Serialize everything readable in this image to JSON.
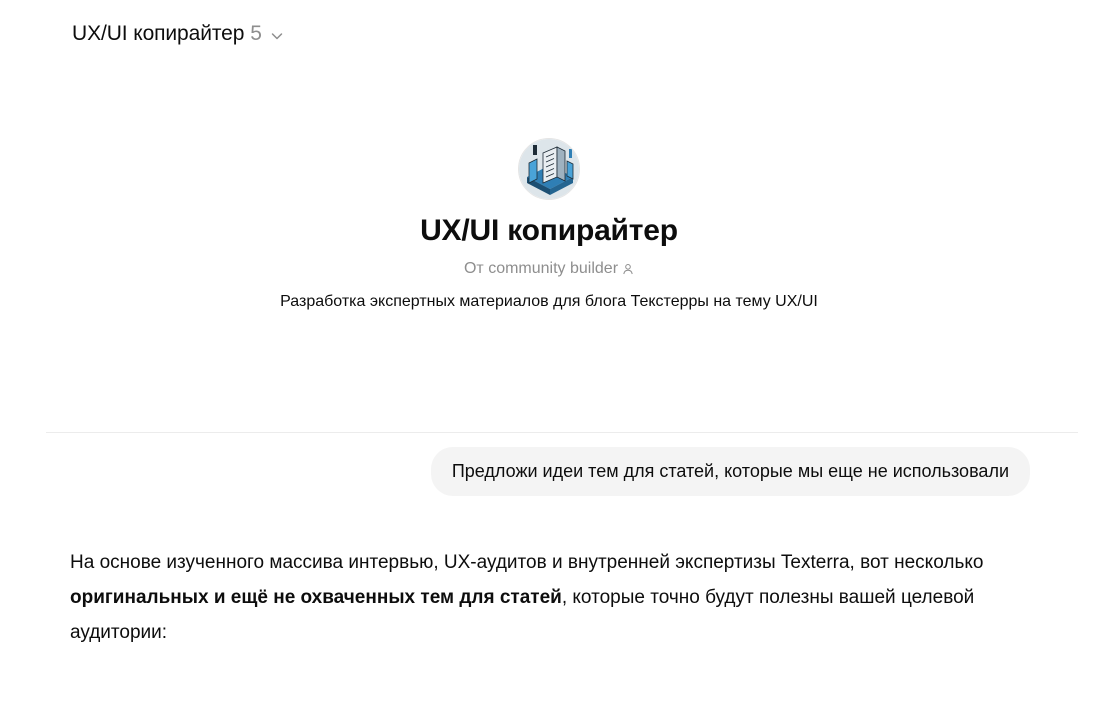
{
  "header": {
    "model_name": "UX/UI копирайтер",
    "model_version": "5",
    "dropdown_icon": "chevron-down-icon"
  },
  "gpt": {
    "title": "UX/UI копирайтер",
    "author_label": "От community builder",
    "author_icon": "person-icon",
    "description": "Разработка экспертных материалов для блога Текстерры на тему UX/UI"
  },
  "conversation": {
    "user_message": "Предложи идеи тем для статей, которые мы еще не использовали",
    "assistant_response": {
      "part1": "На основе изученного массива интервью, UX-аудитов и внутренней экспертизы Texterra, вот несколько ",
      "bold": "оригинальных и ещё не охваченных тем для статей",
      "part2": ", которые точно будут полезны вашей целевой аудитории:"
    }
  },
  "colors": {
    "text": "#0d0d0d",
    "muted": "#8e8e8e",
    "bubble": "#f4f4f4",
    "divider": "#ececec"
  }
}
